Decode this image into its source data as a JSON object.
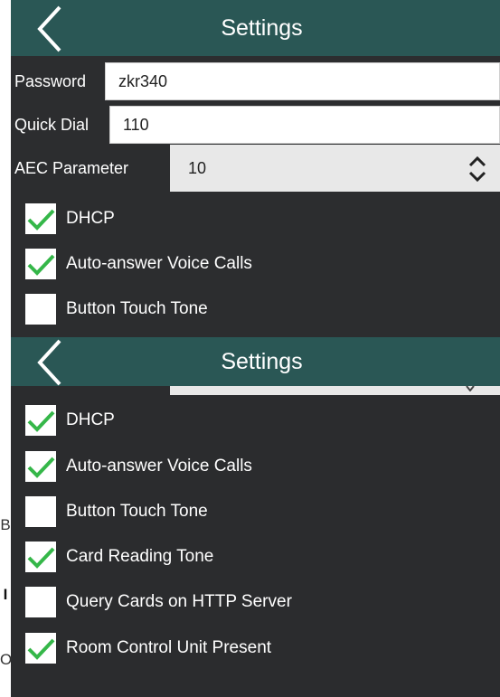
{
  "colors": {
    "header": "#2a5755",
    "panel": "#2c2d2f",
    "check": "#35b749"
  },
  "screen1": {
    "header": {
      "title": "Settings",
      "back_icon": "chevron-left-icon"
    },
    "fields": {
      "password": {
        "label": "Password",
        "value": "zkr340"
      },
      "quick_dial": {
        "label": "Quick Dial",
        "value": "110"
      },
      "aec": {
        "label": "AEC Parameter",
        "value": "10",
        "icon": "up-down-chevron-icon"
      }
    },
    "checkboxes": [
      {
        "label": "DHCP",
        "checked": true
      },
      {
        "label": "Auto-answer Voice Calls",
        "checked": true
      },
      {
        "label": "Button Touch Tone",
        "checked": false
      }
    ]
  },
  "screen2": {
    "header": {
      "title": "Settings",
      "back_icon": "chevron-left-icon"
    },
    "checkboxes": [
      {
        "label": "DHCP",
        "checked": true
      },
      {
        "label": "Auto-answer Voice Calls",
        "checked": true
      },
      {
        "label": "Button Touch Tone",
        "checked": false
      },
      {
        "label": "Card Reading Tone",
        "checked": true
      },
      {
        "label": "Query Cards on HTTP Server",
        "checked": false
      },
      {
        "label": "Room Control Unit Present",
        "checked": true
      }
    ]
  },
  "edge_fragments": {
    "a": "B",
    "b": "I",
    "c": "O"
  }
}
